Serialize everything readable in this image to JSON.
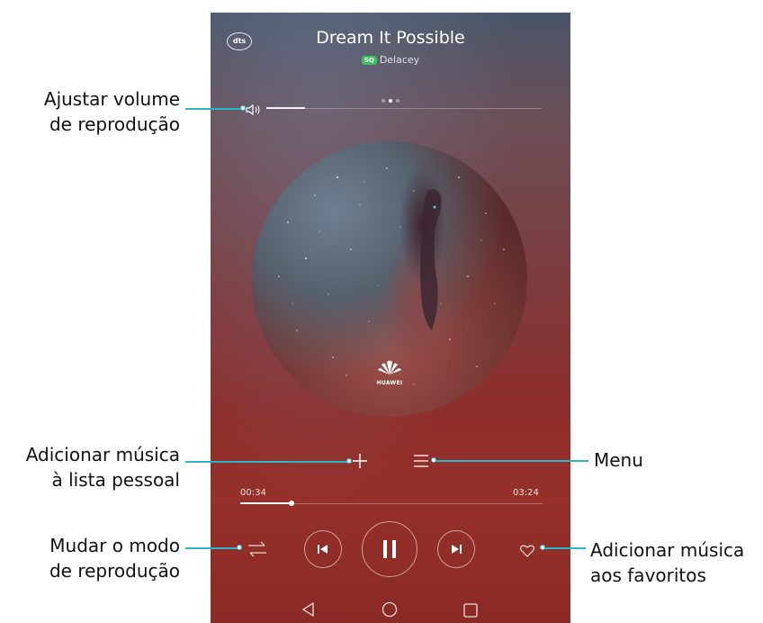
{
  "player": {
    "title": "Dream It Possible",
    "artist": "Delacey",
    "quality_badge": "SQ",
    "dts_label": "dts",
    "elapsed": "00:34",
    "duration": "03:24",
    "progress_fraction": 0.17,
    "volume_fraction": 0.14,
    "album_logo_text": "HUAWEI",
    "page_indicator": {
      "count": 3,
      "active_index": 1
    }
  },
  "icons": {
    "volume": "speaker-icon",
    "add": "plus-icon",
    "menu": "menu-icon",
    "mode": "shuffle-icon",
    "prev": "skip-previous-icon",
    "play_pause": "pause-icon",
    "next": "skip-next-icon",
    "favorite": "heart-icon",
    "nav_back": "back-triangle-icon",
    "nav_home": "home-circle-icon",
    "nav_recent": "recent-square-icon"
  },
  "callouts": {
    "volume_line1": "Ajustar volume",
    "volume_line2": "de reprodução",
    "add_line1": "Adicionar música",
    "add_line2": "à lista pessoal",
    "mode_line1": "Mudar o modo",
    "mode_line2": "de reprodução",
    "menu": "Menu",
    "favorite_line1": "Adicionar música",
    "favorite_line2": "aos favoritos"
  },
  "colors": {
    "callout_line": "#29b6c8",
    "sq_badge": "#39c15a",
    "text": "#111111"
  }
}
